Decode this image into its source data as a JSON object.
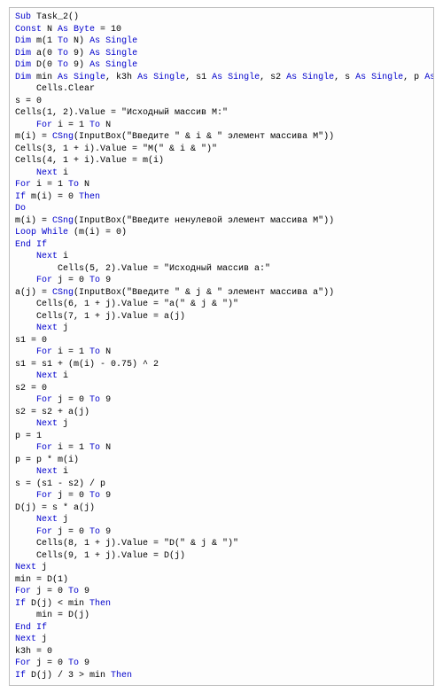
{
  "code": {
    "lines": [
      {
        "indent": 0,
        "segments": [
          {
            "t": "Sub",
            "k": true
          },
          {
            "t": " Task_2()",
            "k": false
          }
        ]
      },
      {
        "indent": 0,
        "segments": [
          {
            "t": "Const",
            "k": true
          },
          {
            "t": " N ",
            "k": false
          },
          {
            "t": "As Byte",
            "k": true
          },
          {
            "t": " = 10",
            "k": false
          }
        ]
      },
      {
        "indent": 0,
        "segments": [
          {
            "t": "Dim",
            "k": true
          },
          {
            "t": " m(1 ",
            "k": false
          },
          {
            "t": "To",
            "k": true
          },
          {
            "t": " N) ",
            "k": false
          },
          {
            "t": "As Single",
            "k": true
          }
        ]
      },
      {
        "indent": 0,
        "segments": [
          {
            "t": "Dim",
            "k": true
          },
          {
            "t": " a(0 ",
            "k": false
          },
          {
            "t": "To",
            "k": true
          },
          {
            "t": " 9) ",
            "k": false
          },
          {
            "t": "As Single",
            "k": true
          }
        ]
      },
      {
        "indent": 0,
        "segments": [
          {
            "t": "Dim",
            "k": true
          },
          {
            "t": " D(0 ",
            "k": false
          },
          {
            "t": "To",
            "k": true
          },
          {
            "t": " 9) ",
            "k": false
          },
          {
            "t": "As Single",
            "k": true
          }
        ]
      },
      {
        "indent": 0,
        "segments": [
          {
            "t": "Dim",
            "k": true
          },
          {
            "t": " min ",
            "k": false
          },
          {
            "t": "As Single",
            "k": true
          },
          {
            "t": ", k3h ",
            "k": false
          },
          {
            "t": "As Single",
            "k": true
          },
          {
            "t": ", s1 ",
            "k": false
          },
          {
            "t": "As Single",
            "k": true
          },
          {
            "t": ", s2 ",
            "k": false
          },
          {
            "t": "As Single",
            "k": true
          },
          {
            "t": ", s ",
            "k": false
          },
          {
            "t": "As Single",
            "k": true
          },
          {
            "t": ", p ",
            "k": false
          },
          {
            "t": "As Single",
            "k": true
          }
        ]
      },
      {
        "indent": 1,
        "segments": [
          {
            "t": "Cells.Clear",
            "k": false
          }
        ]
      },
      {
        "indent": 0,
        "segments": [
          {
            "t": "s = 0",
            "k": false
          }
        ]
      },
      {
        "indent": 0,
        "segments": [
          {
            "t": "Cells(1, 2).Value = \"Исходный массив M:\"",
            "k": false
          }
        ]
      },
      {
        "indent": 1,
        "segments": [
          {
            "t": "For",
            "k": true
          },
          {
            "t": " i = 1 ",
            "k": false
          },
          {
            "t": "To",
            "k": true
          },
          {
            "t": " N",
            "k": false
          }
        ]
      },
      {
        "indent": 0,
        "segments": [
          {
            "t": "m(i) = ",
            "k": false
          },
          {
            "t": "CSng",
            "k": true
          },
          {
            "t": "(InputBox(\"Введите \" & i & \" элемент массива M\"))",
            "k": false
          }
        ]
      },
      {
        "indent": 0,
        "segments": [
          {
            "t": "Cells(3, 1 + i).Value = \"M(\" & i & \")\"",
            "k": false
          }
        ]
      },
      {
        "indent": 0,
        "segments": [
          {
            "t": "Cells(4, 1 + i).Value = m(i)",
            "k": false
          }
        ]
      },
      {
        "indent": 1,
        "segments": [
          {
            "t": "Next",
            "k": true
          },
          {
            "t": " i",
            "k": false
          }
        ]
      },
      {
        "indent": 0,
        "segments": [
          {
            "t": "For",
            "k": true
          },
          {
            "t": " i = 1 ",
            "k": false
          },
          {
            "t": "To",
            "k": true
          },
          {
            "t": " N",
            "k": false
          }
        ]
      },
      {
        "indent": 0,
        "segments": [
          {
            "t": "If",
            "k": true
          },
          {
            "t": " m(i) = 0 ",
            "k": false
          },
          {
            "t": "Then",
            "k": true
          }
        ]
      },
      {
        "indent": 0,
        "segments": [
          {
            "t": "Do",
            "k": true
          }
        ]
      },
      {
        "indent": 0,
        "segments": [
          {
            "t": "m(i) = ",
            "k": false
          },
          {
            "t": "CSng",
            "k": true
          },
          {
            "t": "(InputBox(\"Введите ненулевой элемент массива M\"))",
            "k": false
          }
        ]
      },
      {
        "indent": 0,
        "segments": [
          {
            "t": "Loop While",
            "k": true
          },
          {
            "t": " (m(i) = 0)",
            "k": false
          }
        ]
      },
      {
        "indent": 0,
        "segments": [
          {
            "t": "End If",
            "k": true
          }
        ]
      },
      {
        "indent": 1,
        "segments": [
          {
            "t": "Next",
            "k": true
          },
          {
            "t": " i",
            "k": false
          }
        ]
      },
      {
        "indent": 2,
        "segments": [
          {
            "t": "Cells(5, 2).Value = \"Исходный массив a:\"",
            "k": false
          }
        ]
      },
      {
        "indent": 1,
        "segments": [
          {
            "t": "For",
            "k": true
          },
          {
            "t": " j = 0 ",
            "k": false
          },
          {
            "t": "To",
            "k": true
          },
          {
            "t": " 9",
            "k": false
          }
        ]
      },
      {
        "indent": 0,
        "segments": [
          {
            "t": "a(j) = ",
            "k": false
          },
          {
            "t": "CSng",
            "k": true
          },
          {
            "t": "(InputBox(\"Введите \" & j & \" элемент массива a\"))",
            "k": false
          }
        ]
      },
      {
        "indent": 1,
        "segments": [
          {
            "t": "Cells(6, 1 + j).Value = \"a(\" & j & \")\"",
            "k": false
          }
        ]
      },
      {
        "indent": 1,
        "segments": [
          {
            "t": "Cells(7, 1 + j).Value = a(j)",
            "k": false
          }
        ]
      },
      {
        "indent": 1,
        "segments": [
          {
            "t": "Next",
            "k": true
          },
          {
            "t": " j",
            "k": false
          }
        ]
      },
      {
        "indent": 0,
        "segments": [
          {
            "t": "s1 = 0",
            "k": false
          }
        ]
      },
      {
        "indent": 1,
        "segments": [
          {
            "t": "For",
            "k": true
          },
          {
            "t": " i = 1 ",
            "k": false
          },
          {
            "t": "To",
            "k": true
          },
          {
            "t": " N",
            "k": false
          }
        ]
      },
      {
        "indent": 0,
        "segments": [
          {
            "t": "s1 = s1 + (m(i) - 0.75) ^ 2",
            "k": false
          }
        ]
      },
      {
        "indent": 1,
        "segments": [
          {
            "t": "Next",
            "k": true
          },
          {
            "t": " i",
            "k": false
          }
        ]
      },
      {
        "indent": 0,
        "segments": [
          {
            "t": "s2 = 0",
            "k": false
          }
        ]
      },
      {
        "indent": 1,
        "segments": [
          {
            "t": "For",
            "k": true
          },
          {
            "t": " j = 0 ",
            "k": false
          },
          {
            "t": "To",
            "k": true
          },
          {
            "t": " 9",
            "k": false
          }
        ]
      },
      {
        "indent": 0,
        "segments": [
          {
            "t": "s2 = s2 + a(j)",
            "k": false
          }
        ]
      },
      {
        "indent": 1,
        "segments": [
          {
            "t": "Next",
            "k": true
          },
          {
            "t": " j",
            "k": false
          }
        ]
      },
      {
        "indent": 0,
        "segments": [
          {
            "t": "p = 1",
            "k": false
          }
        ]
      },
      {
        "indent": 1,
        "segments": [
          {
            "t": "For",
            "k": true
          },
          {
            "t": " i = 1 ",
            "k": false
          },
          {
            "t": "To",
            "k": true
          },
          {
            "t": " N",
            "k": false
          }
        ]
      },
      {
        "indent": 0,
        "segments": [
          {
            "t": "p = p * m(i)",
            "k": false
          }
        ]
      },
      {
        "indent": 1,
        "segments": [
          {
            "t": "Next",
            "k": true
          },
          {
            "t": " i",
            "k": false
          }
        ]
      },
      {
        "indent": 0,
        "segments": [
          {
            "t": "s = (s1 - s2) / p",
            "k": false
          }
        ]
      },
      {
        "indent": 1,
        "segments": [
          {
            "t": "For",
            "k": true
          },
          {
            "t": " j = 0 ",
            "k": false
          },
          {
            "t": "To",
            "k": true
          },
          {
            "t": " 9",
            "k": false
          }
        ]
      },
      {
        "indent": 0,
        "segments": [
          {
            "t": "D(j) = s * a(j)",
            "k": false
          }
        ]
      },
      {
        "indent": 1,
        "segments": [
          {
            "t": "Next",
            "k": true
          },
          {
            "t": " j",
            "k": false
          }
        ]
      },
      {
        "indent": 1,
        "segments": [
          {
            "t": "For",
            "k": true
          },
          {
            "t": " j = 0 ",
            "k": false
          },
          {
            "t": "To",
            "k": true
          },
          {
            "t": " 9",
            "k": false
          }
        ]
      },
      {
        "indent": 1,
        "segments": [
          {
            "t": "Cells(8, 1 + j).Value = \"D(\" & j & \")\"",
            "k": false
          }
        ]
      },
      {
        "indent": 1,
        "segments": [
          {
            "t": "Cells(9, 1 + j).Value = D(j)",
            "k": false
          }
        ]
      },
      {
        "indent": 0,
        "segments": [
          {
            "t": "Next",
            "k": true
          },
          {
            "t": " j",
            "k": false
          }
        ]
      },
      {
        "indent": 0,
        "segments": [
          {
            "t": "min = D(1)",
            "k": false
          }
        ]
      },
      {
        "indent": 0,
        "segments": [
          {
            "t": "For",
            "k": true
          },
          {
            "t": " j = 0 ",
            "k": false
          },
          {
            "t": "To",
            "k": true
          },
          {
            "t": " 9",
            "k": false
          }
        ]
      },
      {
        "indent": 0,
        "segments": [
          {
            "t": "If",
            "k": true
          },
          {
            "t": " D(j) < min ",
            "k": false
          },
          {
            "t": "Then",
            "k": true
          }
        ]
      },
      {
        "indent": 1,
        "segments": [
          {
            "t": "min = D(j)",
            "k": false
          }
        ]
      },
      {
        "indent": 0,
        "segments": [
          {
            "t": "End If",
            "k": true
          }
        ]
      },
      {
        "indent": 0,
        "segments": [
          {
            "t": "Next",
            "k": true
          },
          {
            "t": " j",
            "k": false
          }
        ]
      },
      {
        "indent": 0,
        "segments": [
          {
            "t": "k3h = 0",
            "k": false
          }
        ]
      },
      {
        "indent": 0,
        "segments": [
          {
            "t": "For",
            "k": true
          },
          {
            "t": " j = 0 ",
            "k": false
          },
          {
            "t": "To",
            "k": true
          },
          {
            "t": " 9",
            "k": false
          }
        ]
      },
      {
        "indent": 0,
        "segments": [
          {
            "t": "If",
            "k": true
          },
          {
            "t": " D(j) / 3 > min ",
            "k": false
          },
          {
            "t": "Then",
            "k": true
          }
        ]
      }
    ]
  }
}
